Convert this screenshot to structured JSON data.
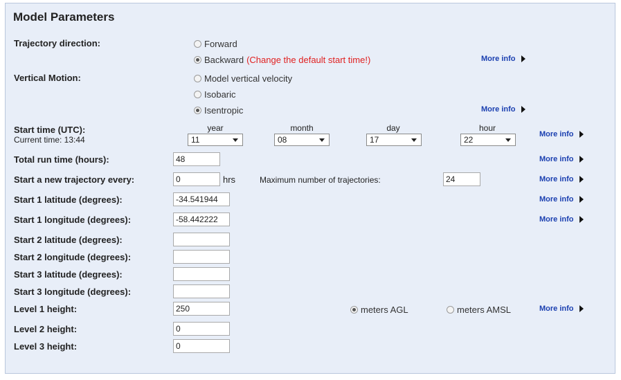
{
  "section": {
    "title": "Model Parameters"
  },
  "trajectory_direction": {
    "label": "Trajectory direction:",
    "options": [
      "Forward",
      "Backward"
    ],
    "selected": "Backward",
    "warning": "(Change the default start time!)"
  },
  "vertical_motion": {
    "label": "Vertical Motion:",
    "options": [
      "Model vertical velocity",
      "Isobaric",
      "Isentropic"
    ],
    "selected": "Isentropic"
  },
  "start_time": {
    "label": "Start time (UTC):",
    "current": "Current time: 13:44",
    "headers": {
      "year": "year",
      "month": "month",
      "day": "day",
      "hour": "hour"
    },
    "values": {
      "year": "11",
      "month": "08",
      "day": "17",
      "hour": "22"
    }
  },
  "run_time": {
    "label": "Total run time (hours):",
    "value": "48"
  },
  "new_trajectory": {
    "label": "Start a new trajectory every:",
    "value": "0",
    "unit": "hrs",
    "max_label": "Maximum number of trajectories:",
    "max_value": "24"
  },
  "coords": [
    {
      "label": "Start 1 latitude (degrees):",
      "value": "-34.541944"
    },
    {
      "label": "Start 1 longitude (degrees):",
      "value": "-58.442222"
    },
    {
      "label": "Start 2 latitude (degrees):",
      "value": ""
    },
    {
      "label": "Start 2 longitude (degrees):",
      "value": ""
    },
    {
      "label": "Start 3 latitude (degrees):",
      "value": ""
    },
    {
      "label": "Start 3 longitude (degrees):",
      "value": ""
    }
  ],
  "levels": [
    {
      "label": "Level 1 height:",
      "value": "250"
    },
    {
      "label": "Level 2 height:",
      "value": "0"
    },
    {
      "label": "Level 3 height:",
      "value": "0"
    }
  ],
  "height_units": {
    "options": [
      "meters AGL",
      "meters AMSL"
    ],
    "selected": "meters AGL"
  },
  "more_info": "More info",
  "colors": {
    "panel_bg": "#e8eef8",
    "link": "#1a3fb0",
    "warning": "#e02020"
  }
}
